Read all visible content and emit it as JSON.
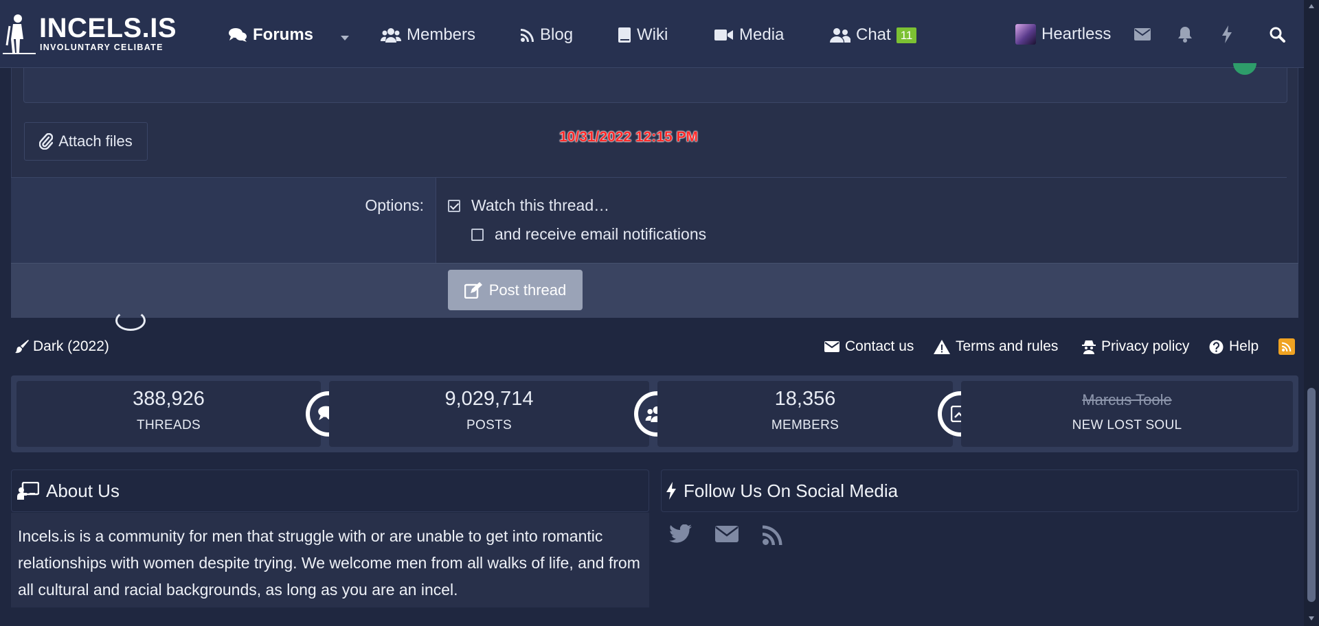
{
  "header": {
    "logo_title": "INCELS.IS",
    "logo_subtitle": "INVOLUNTARY CELIBATE",
    "nav": [
      {
        "label": "Forums",
        "icon": "comments-icon",
        "active": true
      },
      {
        "label": "Members",
        "icon": "users-icon"
      },
      {
        "label": "Blog",
        "icon": "rss-icon"
      },
      {
        "label": "Wiki",
        "icon": "book-icon"
      },
      {
        "label": "Media",
        "icon": "video-icon"
      },
      {
        "label": "Chat",
        "icon": "user-friends-icon",
        "badge": "11"
      }
    ],
    "username": "Heartless",
    "icons": [
      "envelope-icon",
      "bell-icon",
      "bolt-icon",
      "search-icon"
    ]
  },
  "form": {
    "attach_label": "Attach files",
    "timestamp": "10/31/2022 12:15 PM",
    "options_label": "Options:",
    "watch_label": "Watch this thread…",
    "watch_checked": true,
    "email_label": "and receive email notifications",
    "email_checked": false,
    "post_label": "Post thread"
  },
  "footer_links": {
    "style": "Dark (2022)",
    "contact": "Contact us",
    "terms": "Terms and rules",
    "privacy": "Privacy policy",
    "help": "Help"
  },
  "stats": [
    {
      "value": "388,926",
      "label": "THREADS",
      "icon": "comments-icon"
    },
    {
      "value": "9,029,714",
      "label": "POSTS",
      "icon": "users-icon"
    },
    {
      "value": "18,356",
      "label": "MEMBERS",
      "icon": "chart-icon"
    },
    {
      "value": "Marcus Toole",
      "label": "NEW LOST SOUL"
    }
  ],
  "about": {
    "title": "About Us",
    "text": "Incels.is is a community for men that struggle with or are unable to get into romantic relationships with women despite trying. We welcome men from all walks of life, and from all cultural and racial backgrounds, as long as you are an incel."
  },
  "social": {
    "title": "Follow Us On Social Media",
    "icons": [
      "twitter-icon",
      "envelope-icon",
      "rss-icon"
    ]
  },
  "colors": {
    "header_bg": "#273150",
    "page_bg": "#1f2740",
    "badge": "#7cc133",
    "timestamp": "#ff2a2a",
    "rss": "#f0a322",
    "post_button": "#9aa3b7"
  }
}
